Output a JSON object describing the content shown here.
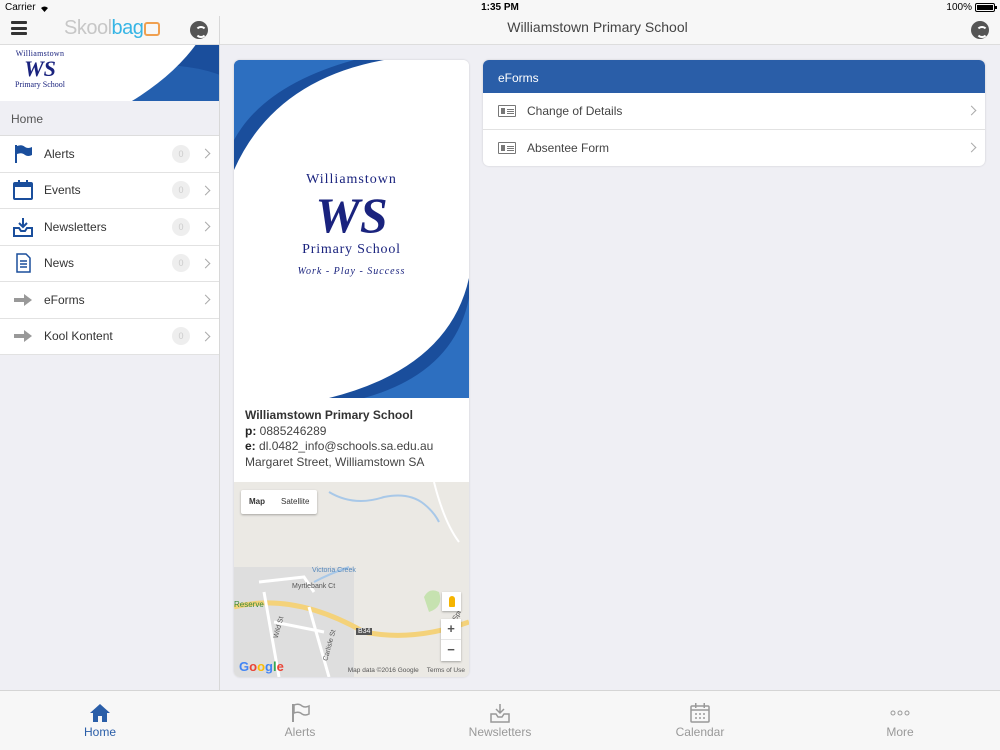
{
  "status": {
    "carrier": "Carrier",
    "time": "1:35 PM",
    "battery": "100%"
  },
  "sidebar": {
    "brand_part1": "Skool",
    "brand_part2": "bag",
    "mini_logo": {
      "line1": "Williamstown",
      "mono": "WS",
      "line2": "Primary School"
    },
    "section": "Home",
    "items": [
      {
        "label": "Alerts",
        "icon": "flag-icon",
        "badge": "0"
      },
      {
        "label": "Events",
        "icon": "calendar-icon",
        "badge": "0"
      },
      {
        "label": "Newsletters",
        "icon": "inbox-download-icon",
        "badge": "0"
      },
      {
        "label": "News",
        "icon": "document-icon",
        "badge": "0"
      },
      {
        "label": "eForms",
        "icon": "arrow-right-icon",
        "badge": ""
      },
      {
        "label": "Kool Kontent",
        "icon": "arrow-right-icon",
        "badge": "0"
      }
    ]
  },
  "header": {
    "title": "Williamstown Primary School"
  },
  "school": {
    "logo": {
      "line1": "Williamstown",
      "mono": "WS",
      "line2": "Primary School",
      "motto": "Work - Play - Success"
    },
    "name": "Williamstown Primary School",
    "phone_label": "p:",
    "phone": "0885246289",
    "email_label": "e:",
    "email": "dl.0482_info@schools.sa.edu.au",
    "address": "Margaret Street, Williamstown SA"
  },
  "map": {
    "type_map": "Map",
    "type_satellite": "Satellite",
    "zoom_in": "+",
    "zoom_out": "−",
    "labels": {
      "creek": "Victoria Creek",
      "street1": "Myrtlebank Ct",
      "reserve": "Reserve",
      "wild": "Wild St",
      "carlisle": "Carlisle St",
      "road": "B34",
      "spring": "Spr"
    },
    "google": "Google",
    "attribution": "Map data ©2016 Google",
    "terms": "Terms of Use"
  },
  "eforms": {
    "title": "eForms",
    "items": [
      {
        "label": "Change of Details"
      },
      {
        "label": "Absentee Form"
      }
    ]
  },
  "tabs": [
    {
      "label": "Home",
      "icon": "home-icon"
    },
    {
      "label": "Alerts",
      "icon": "flag-icon"
    },
    {
      "label": "Newsletters",
      "icon": "inbox-download-icon"
    },
    {
      "label": "Calendar",
      "icon": "calendar-icon"
    },
    {
      "label": "More",
      "icon": "more-dots-icon"
    }
  ],
  "colors": {
    "accent": "#2a5ea8",
    "brand_blue": "#1a4e9c",
    "skoolbag_blue": "#36b5e5"
  }
}
